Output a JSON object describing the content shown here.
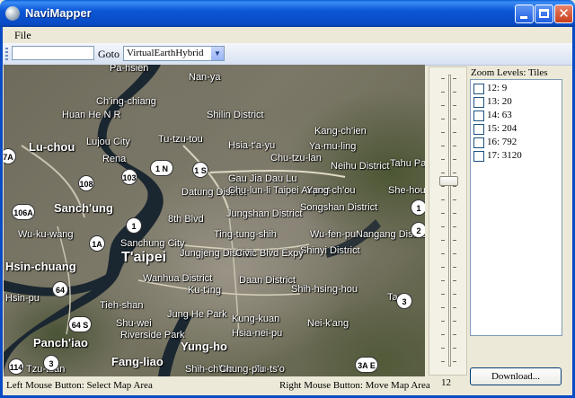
{
  "window": {
    "title": "NaviMapper"
  },
  "menu": {
    "file": "File"
  },
  "toolbar": {
    "address_value": "",
    "goto_label": "Goto",
    "map_type": "VirtualEarthHybrid"
  },
  "map": {
    "labels": [
      {
        "text": "Pa-hsien",
        "cls": ""
      },
      {
        "text": "Ch'ing-chiang",
        "cls": ""
      },
      {
        "text": "Nan-ya",
        "cls": ""
      },
      {
        "text": "Huan He N R",
        "cls": ""
      },
      {
        "text": "Shilin District",
        "cls": ""
      },
      {
        "text": "Kang-ch'ien",
        "cls": ""
      },
      {
        "text": "Lu-chou",
        "cls": "b"
      },
      {
        "text": "Lujou City",
        "cls": ""
      },
      {
        "text": "Tu-tzu-tou",
        "cls": ""
      },
      {
        "text": "Hsia-t'a-yu",
        "cls": ""
      },
      {
        "text": "Ya-mu-ling",
        "cls": ""
      },
      {
        "text": "Rena",
        "cls": ""
      },
      {
        "text": "Chu-tzu-lan",
        "cls": ""
      },
      {
        "text": "Neihu District",
        "cls": ""
      },
      {
        "text": "Tahu Park",
        "cls": ""
      },
      {
        "text": "Gau Jia Dau Lu",
        "cls": ""
      },
      {
        "text": "Datung District",
        "cls": ""
      },
      {
        "text": "Chu-lun-li",
        "cls": ""
      },
      {
        "text": "Taipei Airport",
        "cls": ""
      },
      {
        "text": "Yang-ch'ou",
        "cls": ""
      },
      {
        "text": "She-hou-li",
        "cls": ""
      },
      {
        "text": "Sanch'ung",
        "cls": "b"
      },
      {
        "text": "Jungshan District",
        "cls": ""
      },
      {
        "text": "Songshan District",
        "cls": ""
      },
      {
        "text": "8th Blvd",
        "cls": ""
      },
      {
        "text": "Wu-ku-wang",
        "cls": ""
      },
      {
        "text": "Ting-tung-shih",
        "cls": ""
      },
      {
        "text": "Wu-fen-pu",
        "cls": ""
      },
      {
        "text": "Nangang District",
        "cls": ""
      },
      {
        "text": "Sanchung City",
        "cls": ""
      },
      {
        "text": "T'aipei",
        "cls": "xl"
      },
      {
        "text": "Shinyi District",
        "cls": ""
      },
      {
        "text": "Hsin-chuang",
        "cls": "b"
      },
      {
        "text": "Jungjeng District",
        "cls": ""
      },
      {
        "text": "Civic Blvd Expy",
        "cls": ""
      },
      {
        "text": "Wanhua District",
        "cls": ""
      },
      {
        "text": "Ku-t'ing",
        "cls": ""
      },
      {
        "text": "Daan District",
        "cls": ""
      },
      {
        "text": "Shih-hsing-hou",
        "cls": ""
      },
      {
        "text": "Hsin-pu",
        "cls": ""
      },
      {
        "text": "Tieh-shan",
        "cls": ""
      },
      {
        "text": "Jung He Park",
        "cls": ""
      },
      {
        "text": "Kung-kuan",
        "cls": ""
      },
      {
        "text": "Shu-wei",
        "cls": ""
      },
      {
        "text": "Riverside Park",
        "cls": ""
      },
      {
        "text": "Hsia-nei-pu",
        "cls": ""
      },
      {
        "text": "Nei-k'ang",
        "cls": ""
      },
      {
        "text": "Panch'iao",
        "cls": "b"
      },
      {
        "text": "Yung-ho",
        "cls": "b"
      },
      {
        "text": "Fang-liao",
        "cls": "b"
      },
      {
        "text": "Tzu-tuan",
        "cls": ""
      },
      {
        "text": "Tu-ts'o",
        "cls": ""
      },
      {
        "text": "Shih-ch'iao",
        "cls": ""
      },
      {
        "text": "Chung-p'u",
        "cls": ""
      },
      {
        "text": "Tao",
        "cls": ""
      }
    ],
    "shields": [
      "7A",
      "1 N",
      "1 S",
      "108",
      "103",
      "106A",
      "1",
      "1A",
      "64",
      "64 S",
      "3",
      "114",
      "3",
      "3A E",
      "1",
      "2"
    ]
  },
  "zoom": {
    "value": "12",
    "title": "Zoom Levels: Tiles",
    "levels": [
      "12: 9",
      "13: 20",
      "14: 63",
      "15: 204",
      "16: 792",
      "17: 3120"
    ],
    "thumb_fraction": 0.36
  },
  "download_label": "Download...",
  "status": {
    "left": "Left Mouse Button: Select Map Area",
    "right": "Right Mouse Button: Move Map Area"
  }
}
